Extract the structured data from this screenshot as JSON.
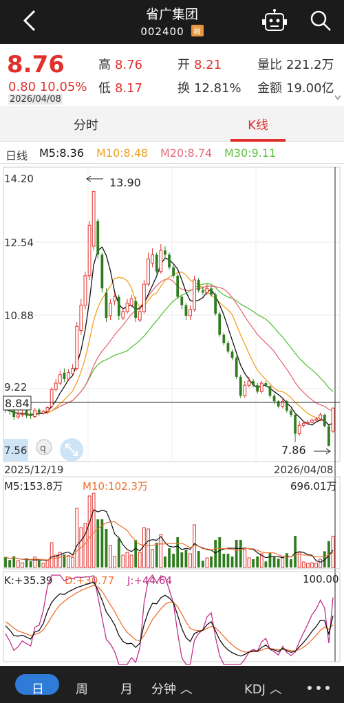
{
  "header": {
    "title": "省广集团",
    "code": "002400",
    "badge": "融",
    "back_icon": "chevron-left-icon",
    "robot_icon": "robot-icon",
    "search_icon": "search-icon"
  },
  "quote": {
    "price": "8.76",
    "change": "0.80",
    "change_pct": "10.05%",
    "date": "2026/04/08",
    "high_label": "高",
    "high": "8.76",
    "low_label": "低",
    "low": "8.17",
    "open_label": "开",
    "open": "8.21",
    "turnover_label": "换",
    "turnover": "12.81%",
    "volratio_label": "量比",
    "volratio": "221.2万",
    "amount_label": "金额",
    "amount": "19.00亿",
    "colors": {
      "up": "#e0302c",
      "down": "#2f7d1f"
    }
  },
  "tabs": {
    "intraday": "分时",
    "kline": "K线",
    "active": "kline"
  },
  "ma_legend": {
    "period": "日线",
    "m5": "M5:8.36",
    "m10": "M10:8.48",
    "m20": "M20:8.74",
    "m30": "M30:9.11",
    "colors": {
      "m5": "#111111",
      "m10": "#f0a020",
      "m20": "#e86a7a",
      "m30": "#5cc23c"
    }
  },
  "chart_data": [
    {
      "type": "candlestick",
      "panel": "price",
      "y_tick_labels": [
        "14.20",
        "12.54",
        "10.88",
        "9.22"
      ],
      "cursor_label": "8.84",
      "low_edge_label": "7.56",
      "max_label": "13.90",
      "min_label": "7.86",
      "x_start_label": "2025/12/19",
      "x_end_label": "2026/04/08",
      "ylim": [
        7.56,
        14.2
      ],
      "close": [
        8.72,
        8.68,
        8.55,
        8.6,
        8.62,
        8.58,
        8.57,
        8.7,
        8.65,
        8.68,
        8.77,
        9.2,
        9.35,
        9.55,
        9.45,
        9.6,
        9.7,
        10.7,
        11.2,
        11.9,
        13.1,
        13.9,
        12.4,
        11.6,
        10.9,
        11.25,
        11.4,
        10.95,
        11.05,
        11.25,
        11.35,
        10.9,
        11.05,
        11.7,
        12.3,
        12.4,
        12.0,
        12.5,
        12.4,
        12.1,
        11.9,
        11.4,
        11.2,
        10.95,
        11.1,
        11.8,
        11.55,
        11.5,
        11.6,
        11.45,
        11.0,
        10.5,
        10.3,
        10.1,
        9.95,
        9.5,
        9.05,
        9.3,
        9.4,
        9.3,
        9.15,
        9.35,
        9.28,
        9.05,
        8.92,
        8.8,
        8.92,
        8.7,
        8.6,
        8.15,
        8.35,
        8.4,
        8.42,
        8.47,
        8.5,
        8.6,
        8.33,
        7.86,
        8.76
      ],
      "open": [
        8.85,
        8.75,
        8.7,
        8.55,
        8.6,
        8.7,
        8.62,
        8.56,
        8.72,
        8.64,
        8.68,
        8.8,
        9.2,
        9.35,
        9.6,
        9.45,
        9.58,
        9.7,
        10.6,
        11.2,
        11.9,
        12.6,
        13.2,
        12.4,
        11.5,
        10.95,
        11.3,
        11.4,
        10.9,
        11.05,
        11.2,
        11.3,
        10.85,
        11.05,
        11.7,
        12.2,
        12.4,
        12.0,
        12.5,
        12.4,
        12.1,
        11.9,
        11.4,
        11.2,
        10.95,
        11.1,
        11.8,
        11.55,
        11.5,
        11.6,
        11.45,
        11.0,
        10.5,
        10.3,
        10.1,
        9.95,
        9.5,
        9.05,
        9.3,
        9.4,
        9.3,
        9.15,
        9.35,
        9.28,
        9.05,
        8.92,
        8.8,
        8.92,
        8.7,
        8.6,
        8.15,
        8.35,
        8.4,
        8.42,
        8.47,
        8.5,
        8.6,
        8.33,
        8.21
      ],
      "high": [
        8.9,
        8.8,
        8.74,
        8.7,
        8.7,
        8.74,
        8.68,
        8.76,
        8.76,
        8.72,
        8.8,
        9.25,
        9.45,
        9.65,
        9.7,
        9.68,
        9.8,
        10.8,
        11.35,
        12.0,
        13.2,
        13.9,
        13.25,
        12.45,
        11.6,
        11.35,
        11.5,
        11.45,
        11.15,
        11.35,
        11.45,
        11.4,
        11.15,
        11.8,
        12.45,
        12.55,
        12.45,
        12.65,
        12.6,
        12.45,
        12.15,
        11.95,
        11.45,
        11.25,
        11.2,
        11.9,
        11.85,
        11.65,
        11.7,
        11.65,
        11.5,
        11.05,
        10.55,
        10.35,
        10.15,
        10.0,
        9.55,
        9.4,
        9.5,
        9.45,
        9.35,
        9.4,
        9.4,
        9.3,
        9.1,
        8.95,
        8.98,
        8.95,
        8.75,
        8.65,
        8.45,
        8.45,
        8.48,
        8.52,
        8.55,
        8.65,
        8.62,
        8.35,
        8.76
      ],
      "low": [
        8.65,
        8.6,
        8.48,
        8.5,
        8.55,
        8.52,
        8.5,
        8.52,
        8.58,
        8.6,
        8.62,
        8.75,
        9.15,
        9.3,
        9.38,
        9.4,
        9.55,
        9.65,
        10.5,
        11.1,
        11.8,
        12.5,
        12.3,
        11.5,
        10.8,
        10.85,
        11.2,
        10.85,
        10.85,
        11.0,
        11.15,
        10.8,
        10.8,
        11.0,
        11.65,
        12.1,
        11.95,
        11.95,
        12.3,
        12.05,
        11.85,
        11.35,
        11.1,
        10.85,
        10.85,
        11.05,
        11.5,
        11.45,
        11.45,
        11.4,
        10.95,
        10.45,
        10.25,
        10.05,
        9.9,
        9.45,
        9.0,
        9.0,
        9.25,
        9.25,
        9.1,
        9.1,
        9.25,
        9.0,
        8.85,
        8.75,
        8.75,
        8.65,
        8.55,
        7.95,
        8.1,
        8.3,
        8.35,
        8.4,
        8.42,
        8.45,
        8.3,
        7.86,
        8.17
      ]
    },
    {
      "type": "bar",
      "panel": "volume",
      "m5_label": "M5:153.8万",
      "m10_label": "M10:102.3万",
      "max_label": "696.01万"
    },
    {
      "type": "line",
      "panel": "kdj",
      "k_label": "K:+35.39",
      "d_label": "D:+30.77",
      "j_label": "J:+44.64",
      "max_label": "100.00",
      "colors": {
        "k": "#111111",
        "d": "#f07030",
        "j": "#c0308a"
      }
    }
  ],
  "bottom_bar": {
    "day": "日",
    "week": "周",
    "month": "月",
    "minute": "分钟 ︿",
    "indicator": "KDJ ︿",
    "more_icon": "more-dots-icon"
  }
}
